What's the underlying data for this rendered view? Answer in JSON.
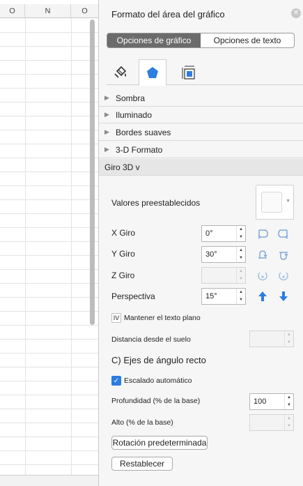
{
  "sheet": {
    "columns": [
      "O",
      "N",
      "O"
    ]
  },
  "pane": {
    "title": "Formato del área del gráfico",
    "close_label": "✕",
    "segments": [
      "Opciones de gráfico",
      "Opciones de texto"
    ],
    "icon_tabs": [
      "fill-bucket-icon",
      "pentagon-effects-icon",
      "size-properties-icon"
    ],
    "sections": [
      "Sombra",
      "Iluminado",
      "Bordes suaves",
      "3-D Formato",
      "Giro 3D v"
    ],
    "presets_label": "Valores preestablecidos",
    "x_rotation": {
      "label": "X Giro",
      "value": "0°"
    },
    "y_rotation": {
      "label": "Y Giro",
      "value": "30°"
    },
    "z_rotation": {
      "label": "Z Giro",
      "value": ""
    },
    "perspective": {
      "label": "Perspectiva",
      "value": "15°"
    },
    "keep_text_flat": {
      "label": "Mantener el texto plano",
      "checked": false,
      "box_text": "IV"
    },
    "distance_from_ground": {
      "label": "Distancia desde el suelo",
      "value": ""
    },
    "right_angle_axes_label": "C) Ejes de ángulo recto",
    "autoscale": {
      "label": "Escalado automático",
      "checked": true,
      "mark": "✓"
    },
    "depth": {
      "label": "Profundidad (% de la base)",
      "value": "100"
    },
    "height": {
      "label": "Alto (% de la base)",
      "value": ""
    },
    "default_rotation_button": "Rotación predeterminada",
    "reset_button": "Restablecer"
  },
  "colors": {
    "accent": "#2b7de0",
    "segment_active": "#6b6b6b"
  }
}
